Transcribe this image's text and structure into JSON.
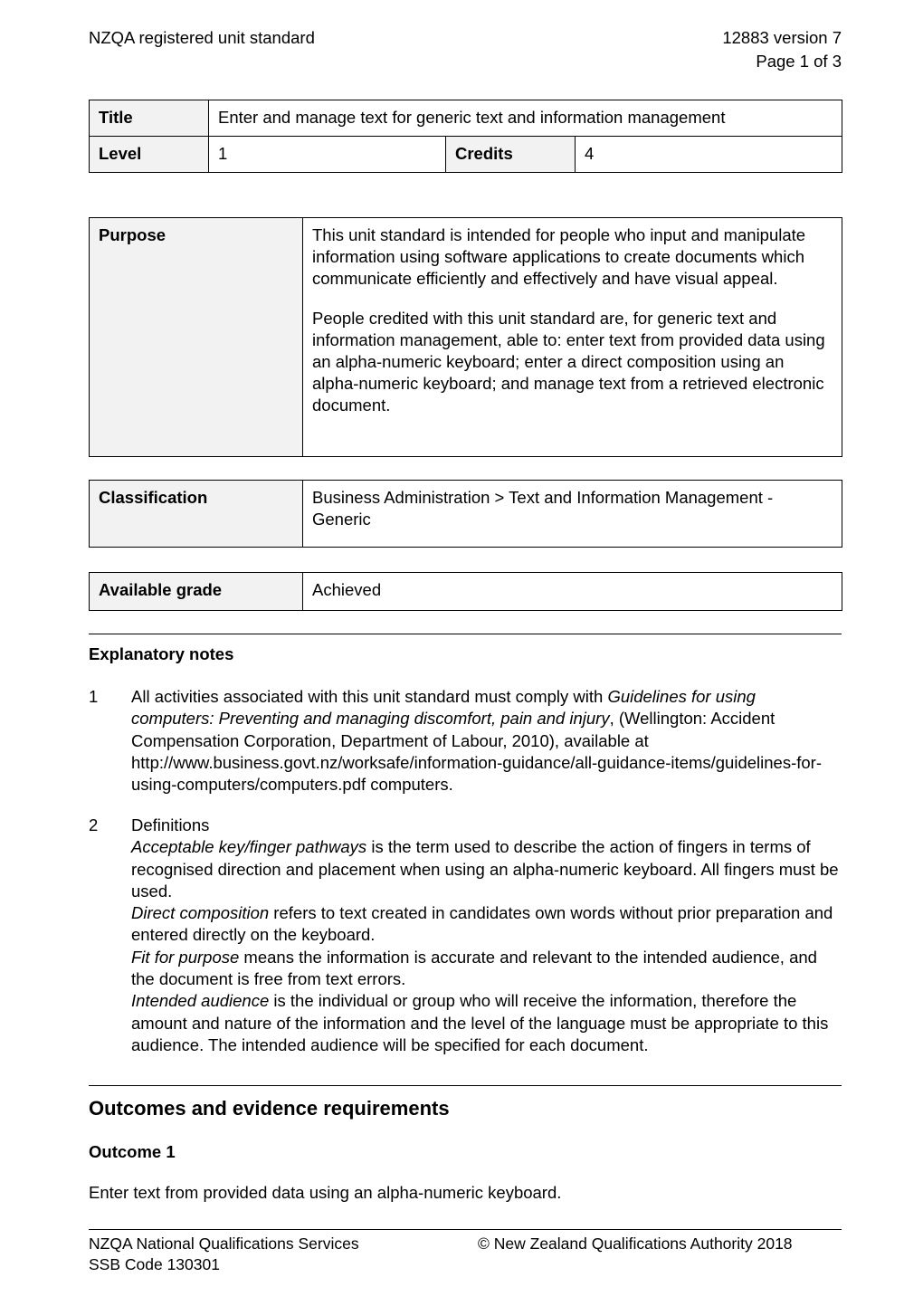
{
  "header": {
    "left": "NZQA registered unit standard",
    "standard_version": "12883 version 7",
    "page_number": "Page 1 of 3"
  },
  "title_table": {
    "title_label": "Title",
    "title_value": "Enter and manage text for generic text and information management",
    "level_label": "Level",
    "level_value": "1",
    "credits_label": "Credits",
    "credits_value": "4"
  },
  "purpose_table": {
    "label": "Purpose",
    "paragraph_1": "This unit standard is intended for people who input and manipulate information using software applications to create documents which communicate efficiently and effectively and have visual appeal.",
    "paragraph_2": "People credited with this unit standard are, for generic text and information management, able to: enter text from provided data using an alpha-numeric keyboard; enter a direct composition using an alpha-numeric keyboard; and manage text from a retrieved electronic document."
  },
  "classification_table": {
    "label": "Classification",
    "value": "Business Administration > Text and Information Management - Generic"
  },
  "grade_table": {
    "label": "Available grade",
    "value": "Achieved"
  },
  "explanatory_notes": {
    "heading": "Explanatory notes",
    "note_1": {
      "number": "1",
      "text_before_italic": "All activities associated with this unit standard must comply with ",
      "italic_title": "Guidelines for using computers: Preventing and managing discomfort, pain and injury",
      "text_after_italic": ", (Wellington: Accident Compensation Corporation, Department of Labour, 2010), available at http://www.business.govt.nz/worksafe/information-guidance/all-guidance-items/guidelines-for-using-computers/computers.pdf computers."
    },
    "note_2": {
      "number": "2",
      "heading": "Definitions",
      "definitions": [
        {
          "term": "Acceptable key/finger pathways",
          "body": " is the term used to describe the action of fingers in terms of recognised direction and placement when using an alpha-numeric keyboard. All fingers must be used."
        },
        {
          "term": "Direct composition",
          "body": " refers to text created in candidates own words without prior preparation and entered directly on the keyboard."
        },
        {
          "term": "Fit for purpose",
          "body": " means the information is accurate and relevant to the intended audience, and the document is free from text errors."
        },
        {
          "term": "Intended audience",
          "body": " is the individual or group who will receive the information, therefore the amount and nature of the information and the level of the language must be appropriate to this audience.  The intended audience will be specified for each document."
        }
      ]
    }
  },
  "outcomes": {
    "heading": "Outcomes and evidence requirements",
    "outcome_1_heading": "Outcome 1",
    "outcome_1_text": "Enter text from provided data using an alpha-numeric keyboard."
  },
  "footer": {
    "left_line_1": "NZQA National Qualifications Services",
    "left_line_2": "SSB Code 130301",
    "right": "© New Zealand Qualifications Authority 2018"
  }
}
